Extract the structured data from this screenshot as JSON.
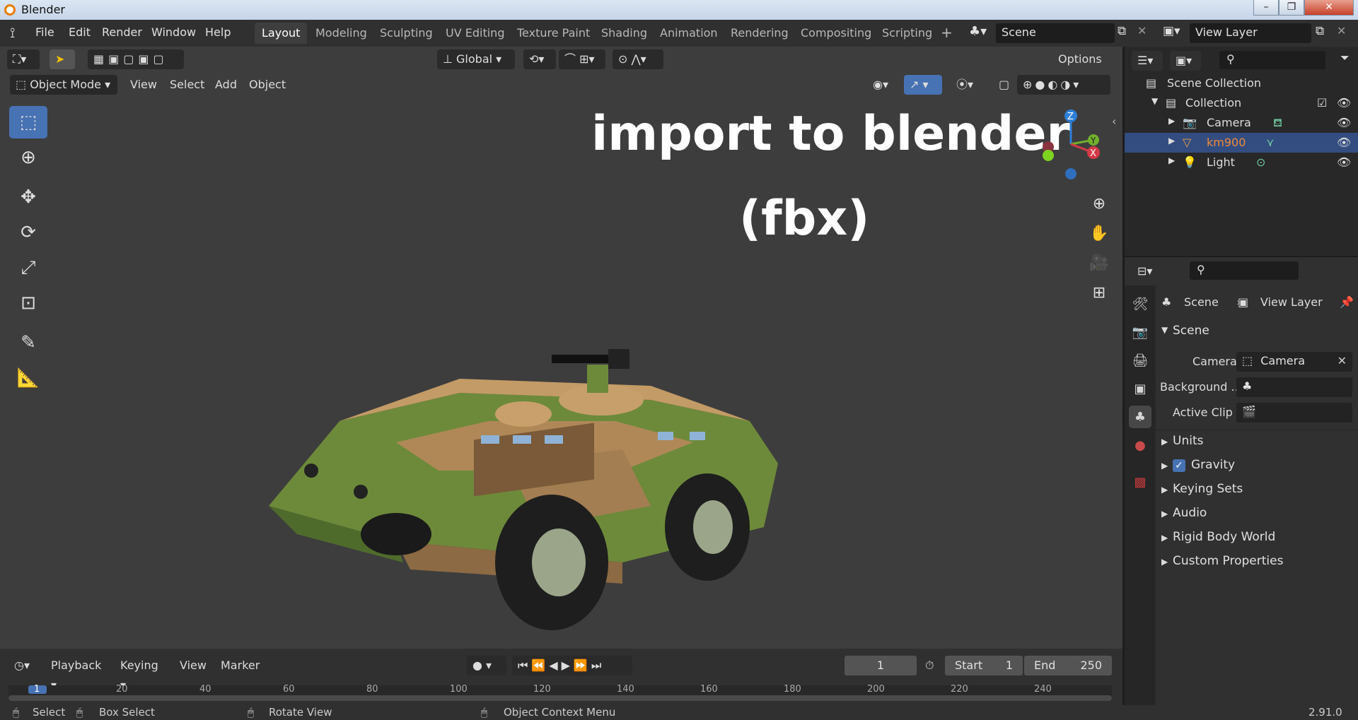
{
  "window": {
    "title": "Blender",
    "min": "–",
    "max": "❐",
    "close": "✕"
  },
  "menu": {
    "items": [
      "File",
      "Edit",
      "Render",
      "Window",
      "Help"
    ]
  },
  "workspaces": [
    "Layout",
    "Modeling",
    "Sculpting",
    "UV Editing",
    "Texture Paint",
    "Shading",
    "Animation",
    "Rendering",
    "Compositing",
    "Scripting"
  ],
  "scene_name": "Scene",
  "view_layer_name": "View Layer",
  "viewport_header": {
    "mode": "Object Mode",
    "menus": [
      "View",
      "Select",
      "Add",
      "Object"
    ],
    "transform_orientation": "Global",
    "options": "Options"
  },
  "overlay_text": {
    "line1": "import to blender",
    "line2": "(fbx)"
  },
  "gizmo": {
    "z": "Z",
    "x": "X",
    "y": "Y"
  },
  "outliner": {
    "root": "Scene Collection",
    "collection": "Collection",
    "objects": [
      {
        "name": "Camera",
        "color": "#dcdcdc",
        "selected": false
      },
      {
        "name": "km900",
        "color": "#f0893a",
        "selected": true
      },
      {
        "name": "Light",
        "color": "#dcdcdc",
        "selected": false
      }
    ]
  },
  "properties": {
    "breadcrumb_scene": "Scene",
    "breadcrumb_view_layer": "View Layer",
    "section_scene": "Scene",
    "camera_label": "Camera",
    "camera_value": "Camera",
    "background_label": "Background ...",
    "active_clip_label": "Active Clip",
    "sections": [
      "Units",
      "Gravity",
      "Keying Sets",
      "Audio",
      "Rigid Body World",
      "Custom Properties"
    ],
    "gravity_checked": true
  },
  "timeline": {
    "menus": [
      "Playback",
      "Keying",
      "View",
      "Marker"
    ],
    "current_frame": "1",
    "start_label": "Start",
    "start_value": "1",
    "end_label": "End",
    "end_value": "250",
    "ruler_ticks": [
      "1",
      "20",
      "40",
      "60",
      "80",
      "100",
      "120",
      "140",
      "160",
      "180",
      "200",
      "220",
      "240"
    ]
  },
  "statusbar": {
    "select": "Select",
    "box_select": "Box Select",
    "rotate_view": "Rotate View",
    "context_menu": "Object Context Menu",
    "version": "2.91.0"
  },
  "colors": {
    "accent": "#4772b3",
    "selection": "#334d80",
    "active_object": "#f0893a"
  }
}
